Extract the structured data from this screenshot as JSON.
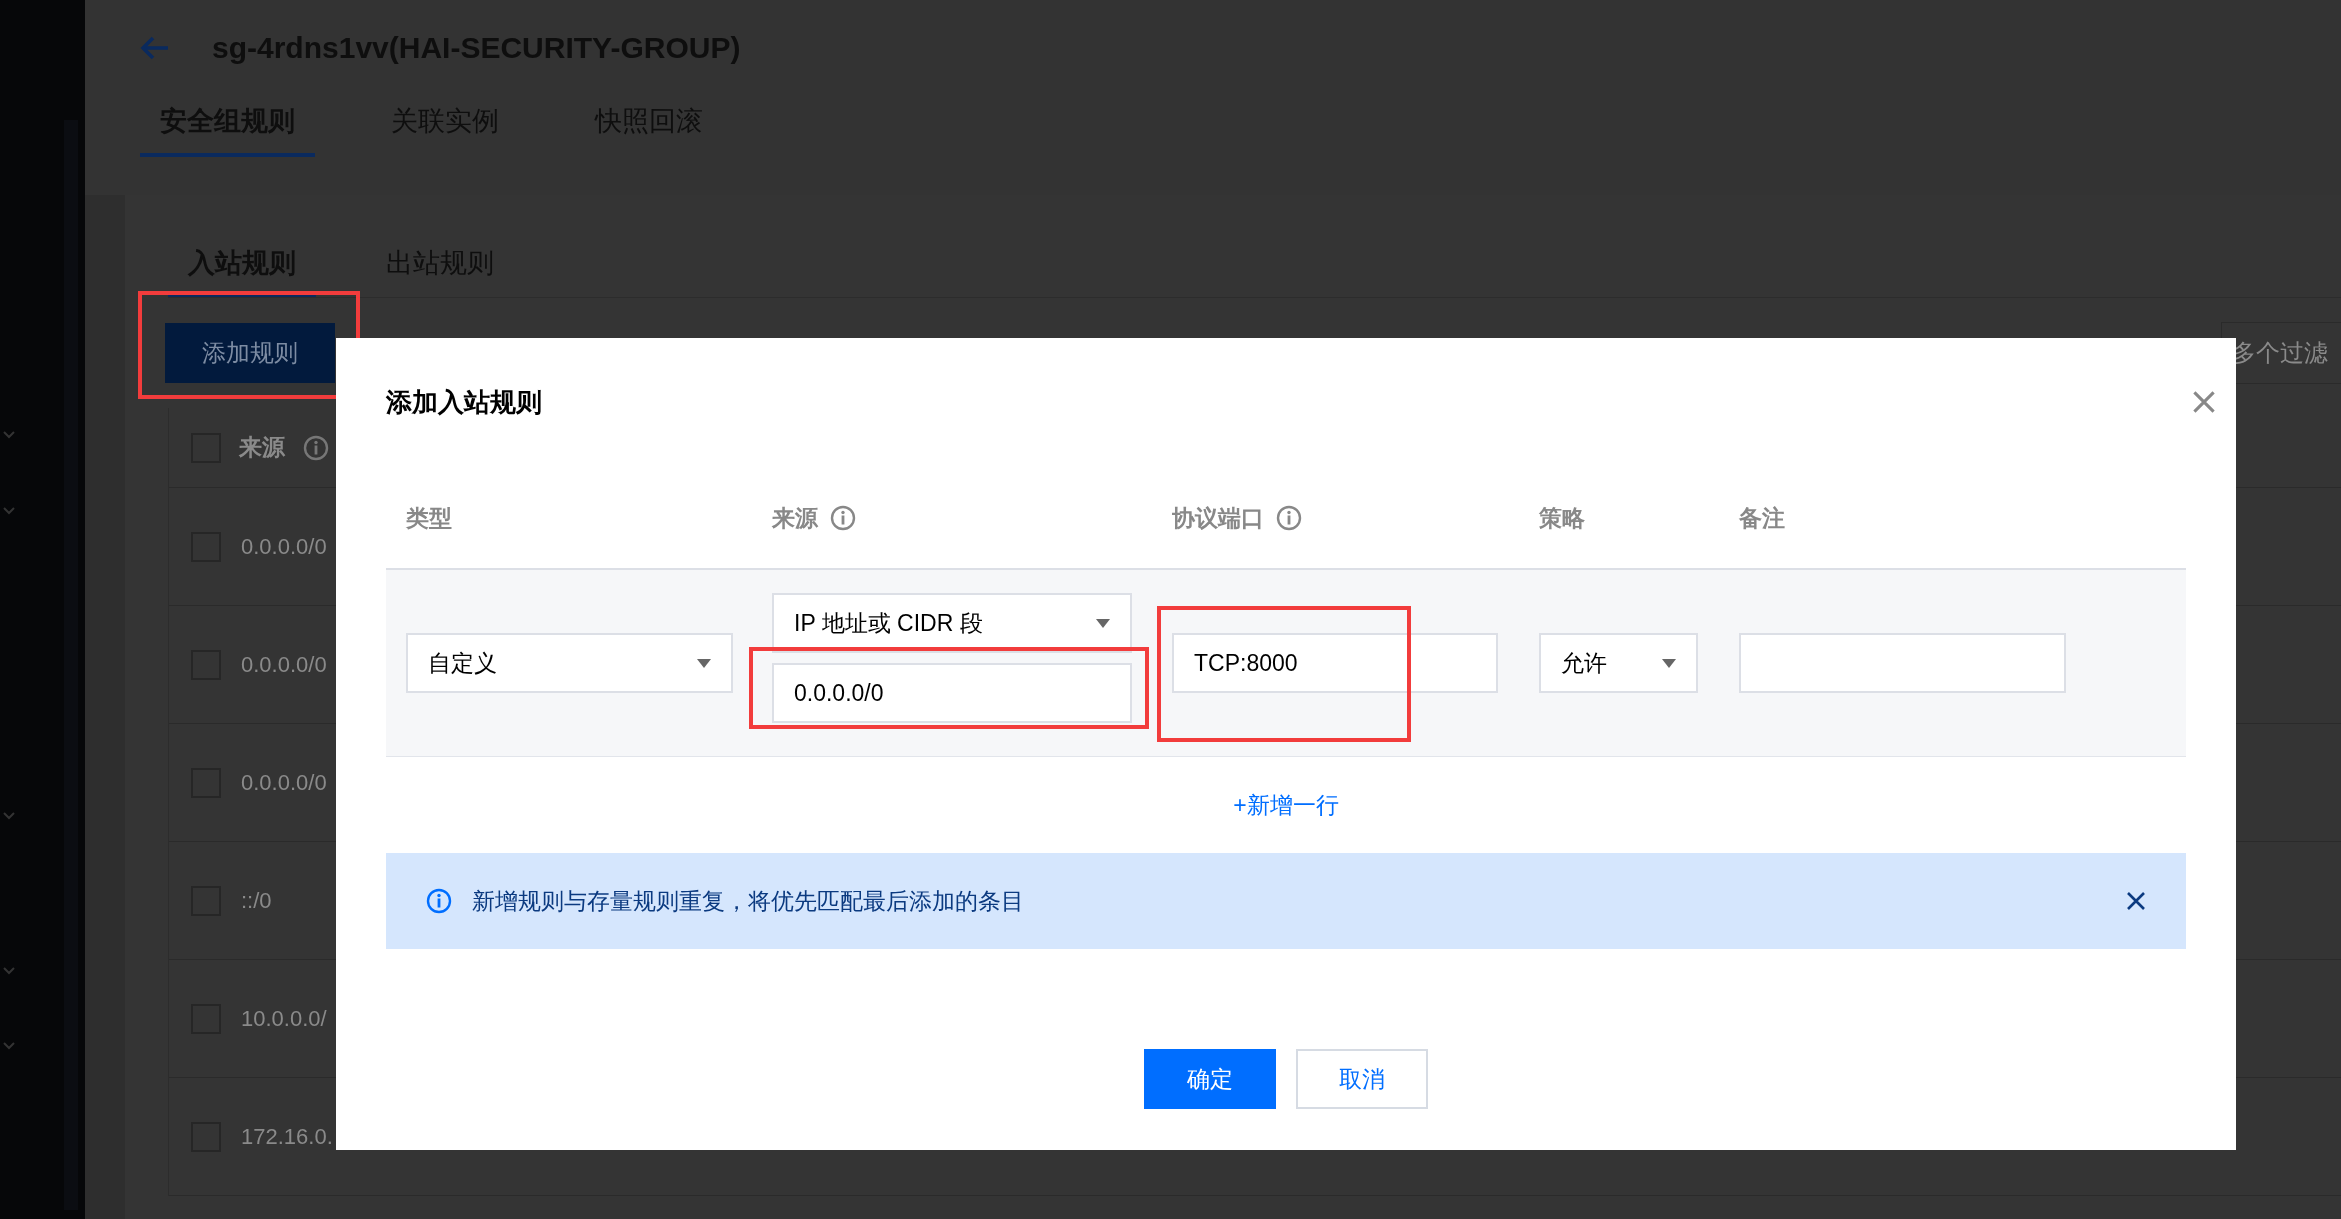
{
  "page": {
    "title": "sg-4rdns1vv(HAI-SECURITY-GROUP)",
    "tabs": [
      {
        "label": "安全组规则",
        "selected": true
      },
      {
        "label": "关联实例",
        "selected": false
      },
      {
        "label": "快照回滚",
        "selected": false
      }
    ],
    "sub_tabs": [
      {
        "label": "入站规则",
        "selected": true
      },
      {
        "label": "出站规则",
        "selected": false
      }
    ],
    "add_button": {
      "label": "添加规则",
      "highlighted": true
    },
    "filter": {
      "placeholder": "多个过滤"
    },
    "table": {
      "header": "来源",
      "header_checked": false,
      "rows": [
        {
          "source": "0.0.0.0/0",
          "checked": false
        },
        {
          "source": "0.0.0.0/0",
          "checked": false
        },
        {
          "source": "0.0.0.0/0",
          "checked": false
        },
        {
          "source": "::/0",
          "checked": false
        },
        {
          "source": "10.0.0.0/",
          "checked": false
        },
        {
          "source": "172.16.0.",
          "checked": false
        }
      ]
    }
  },
  "dialog": {
    "title": "添加入站规则",
    "columns": [
      {
        "label": "类型",
        "info": false
      },
      {
        "label": "来源",
        "info": true
      },
      {
        "label": "协议端口",
        "info": true
      },
      {
        "label": "策略",
        "info": false
      },
      {
        "label": "备注",
        "info": false
      }
    ],
    "row": {
      "type": "自定义",
      "source_kind": "IP 地址或 CIDR 段",
      "source": {
        "value": "0.0.0.0/0",
        "highlighted": true
      },
      "port": {
        "value": "TCP:8000",
        "highlighted": true
      },
      "policy": "允许"
    },
    "add_row": "+新增一行",
    "alert": "新增规则与存量规则重复，将优先匹配最后添加的条目",
    "buttons": [
      {
        "label": "确定",
        "kind": "primary"
      },
      {
        "label": "取消",
        "kind": "default"
      }
    ]
  }
}
